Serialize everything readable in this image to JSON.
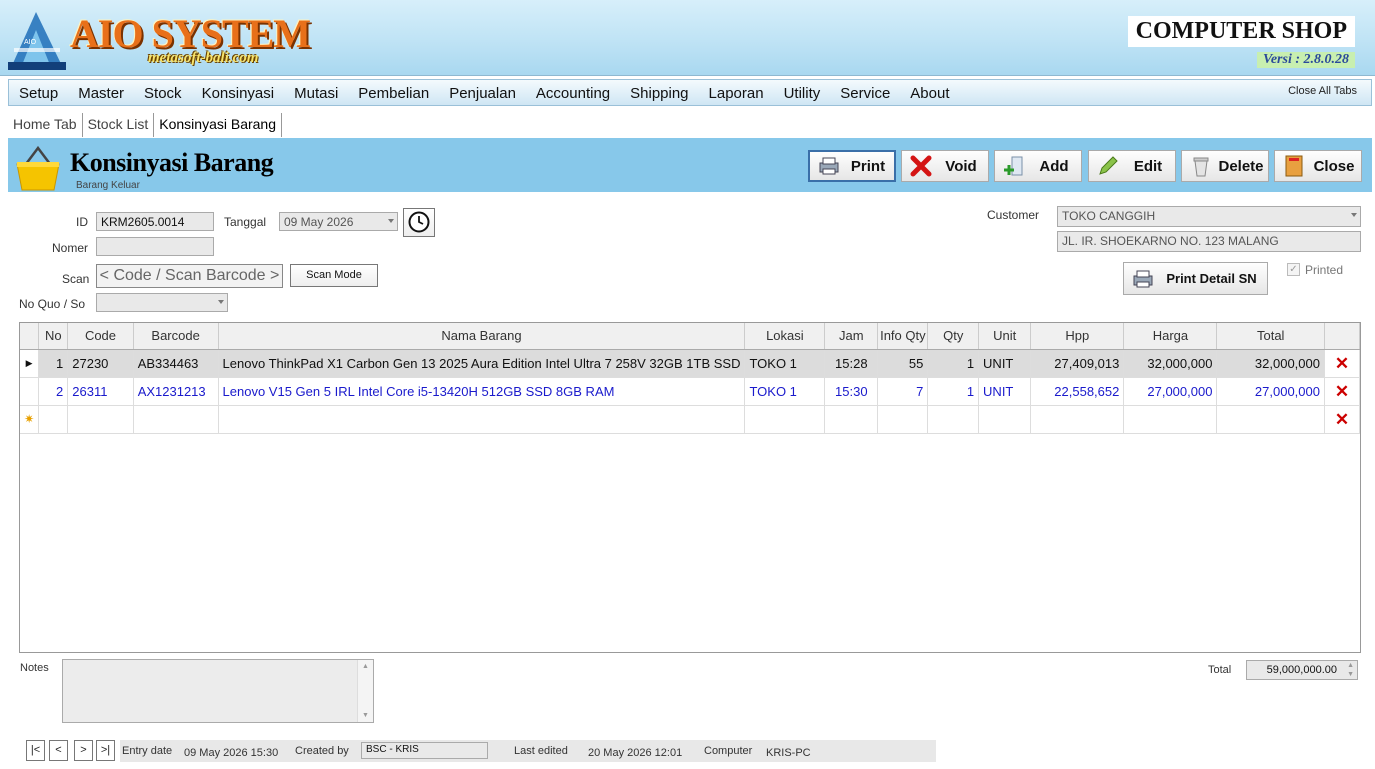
{
  "app": {
    "title": "AIO SYSTEM",
    "subtitle": "metasoft-bali.com",
    "shop": "COMPUTER SHOP",
    "version": "Versi : 2.8.0.28"
  },
  "menu": [
    "Setup",
    "Master",
    "Stock",
    "Konsinyasi",
    "Mutasi",
    "Pembelian",
    "Penjualan",
    "Accounting",
    "Shipping",
    "Laporan",
    "Utility",
    "Service",
    "About"
  ],
  "close_all": "Close All Tabs",
  "tabs": [
    "Home Tab",
    "Stock List",
    "Konsinyasi Barang"
  ],
  "panel": {
    "title": "Konsinyasi Barang",
    "subtitle": "Barang Keluar"
  },
  "toolbar": {
    "print": "Print",
    "void": "Void",
    "add": "Add",
    "edit": "Edit",
    "delete": "Delete",
    "close": "Close"
  },
  "form": {
    "id_label": "ID",
    "id_value": "KRM2605.0014",
    "tanggal_label": "Tanggal",
    "tanggal_value": "09 May 2026",
    "nomer_label": "Nomer",
    "nomer_value": "",
    "scan_label": "Scan",
    "scan_placeholder": "< Code / Scan Barcode >",
    "scan_mode": "Scan Mode",
    "noquo_label": "No Quo / So",
    "noquo_value": "",
    "customer_label": "Customer",
    "customer_value": "TOKO CANGGIH",
    "address": "JL. IR. SHOEKARNO NO. 123 MALANG",
    "print_detail": "Print Detail SN",
    "printed_label": "Printed",
    "printed_checked": true
  },
  "grid": {
    "columns": [
      "No",
      "Code",
      "Barcode",
      "Nama Barang",
      "Lokasi",
      "Jam",
      "Info Qty",
      "Qty",
      "Unit",
      "Hpp",
      "Harga",
      "Total"
    ],
    "rows": [
      [
        "1",
        "27230",
        "AB334463",
        "Lenovo ThinkPad X1 Carbon Gen 13 2025 Aura Edition Intel Ultra 7 258V 32GB 1TB SSD",
        "TOKO 1",
        "15:28",
        "55",
        "1",
        "UNIT",
        "27,409,013",
        "32,000,000",
        "32,000,000"
      ],
      [
        "2",
        "26311",
        "AX1231213",
        "Lenovo V15 Gen 5 IRL Intel Core i5-13420H 512GB SSD 8GB RAM",
        "TOKO 1",
        "15:30",
        "7",
        "1",
        "UNIT",
        "22,558,652",
        "27,000,000",
        "27,000,000"
      ]
    ]
  },
  "notes": {
    "label": "Notes",
    "value": ""
  },
  "total": {
    "label": "Total",
    "value": "59,000,000.00"
  },
  "footer": {
    "nav": [
      "|<",
      "<",
      ">",
      ">|"
    ],
    "entry_label": "Entry date",
    "entry_value": "09 May 2026 15:30",
    "created_label": "Created by",
    "created_value": "BSC - KRIS",
    "edited_label": "Last edited",
    "edited_value": "20 May 2026 12:01",
    "computer_label": "Computer",
    "computer_value": "KRIS-PC"
  },
  "colors": {
    "header_bg": "#bfe3f5",
    "panel_bg": "#87c8ea",
    "logo_orange": "#e8701a",
    "row_blue": "#1a1acc"
  }
}
